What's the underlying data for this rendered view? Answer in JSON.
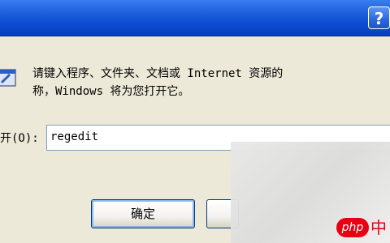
{
  "window": {
    "help_label": "?"
  },
  "dialog": {
    "prompt_line1": "请键入程序、文件夹、文档或 Internet 资源的",
    "prompt_line2": "称，Windows 将为您打开它。",
    "open_label": "开(O):",
    "open_value": "regedit",
    "ok_label": "确定",
    "cancel_label": ""
  },
  "watermark": {
    "text": "php",
    "cn": "中"
  },
  "colors": {
    "title_blue": "#0a4bd0",
    "dialog_bg": "#ece9d8",
    "button_border": "#003c74",
    "watermark_red": "#e60012"
  },
  "icons": {
    "help": "help-icon",
    "app": "run-icon"
  }
}
